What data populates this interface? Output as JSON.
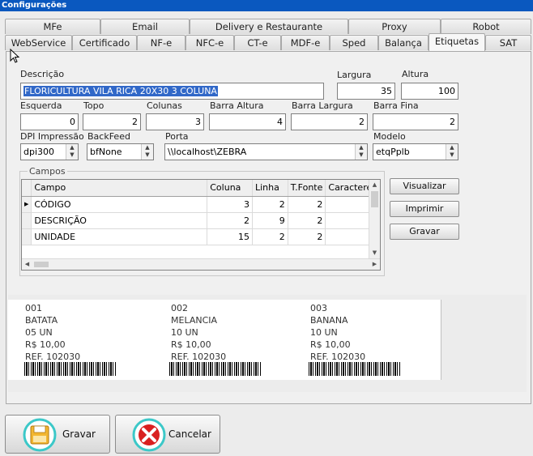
{
  "window": {
    "title": "Configurações"
  },
  "tabs_row1": [
    "MFe",
    "Email",
    "Delivery e Restaurante",
    "Proxy",
    "Robot"
  ],
  "tabs_row2": [
    "WebService",
    "Certificado",
    "NF-e",
    "NFC-e",
    "CT-e",
    "MDF-e",
    "Sped",
    "Balança",
    "Etiquetas",
    "SAT"
  ],
  "active_tab": "Etiquetas",
  "form": {
    "descricao": {
      "label": "Descrição",
      "value": "FLORICULTURA VILA RICA 20X30 3 COLUNA"
    },
    "largura": {
      "label": "Largura",
      "value": "35"
    },
    "altura": {
      "label": "Altura",
      "value": "100"
    },
    "esquerda": {
      "label": "Esquerda",
      "value": "0"
    },
    "topo": {
      "label": "Topo",
      "value": "2"
    },
    "colunas": {
      "label": "Colunas",
      "value": "3"
    },
    "barra_altura": {
      "label": "Barra Altura",
      "value": "4"
    },
    "barra_largura": {
      "label": "Barra Largura",
      "value": "2"
    },
    "barra_fina": {
      "label": "Barra Fina",
      "value": "2"
    },
    "dpi": {
      "label": "DPI Impressão",
      "value": "dpi300"
    },
    "backfeed": {
      "label": "BackFeed",
      "value": "bfNone"
    },
    "porta": {
      "label": "Porta",
      "value": "\\\\localhost\\ZEBRA"
    },
    "modelo": {
      "label": "Modelo",
      "value": "etqPplb"
    }
  },
  "campos": {
    "label": "Campos",
    "columns": [
      "Campo",
      "Coluna",
      "Linha",
      "T.Fonte",
      "Caracteres"
    ],
    "rows": [
      [
        "CÓDIGO",
        "3",
        "2",
        "2",
        ""
      ],
      [
        "DESCRIÇÃO",
        "2",
        "9",
        "2",
        ""
      ],
      [
        "UNIDADE",
        "15",
        "2",
        "2",
        ""
      ]
    ]
  },
  "actions": {
    "visualizar": "Visualizar",
    "imprimir": "Imprimir",
    "gravar": "Gravar"
  },
  "labels_preview": [
    {
      "code": "001",
      "name": "BATATA",
      "unit": "05 UN",
      "price": "R$ 10,00",
      "ref": "REF. 102030"
    },
    {
      "code": "002",
      "name": "MELANCIA",
      "unit": "10 UN",
      "price": "R$ 10,00",
      "ref": "REF. 102030"
    },
    {
      "code": "003",
      "name": "BANANA",
      "unit": "10 UN",
      "price": "R$ 10,00",
      "ref": "REF. 102030"
    }
  ],
  "footer": {
    "gravar": "Gravar",
    "cancelar": "Cancelar"
  },
  "icons": {
    "save": "floppy-disk-icon",
    "cancel": "cancel-x-icon"
  },
  "colors": {
    "title_bar": "#0a58bf",
    "selection": "#3168c8",
    "save_ring": "#3cc8c8",
    "cancel_red": "#d92020"
  }
}
